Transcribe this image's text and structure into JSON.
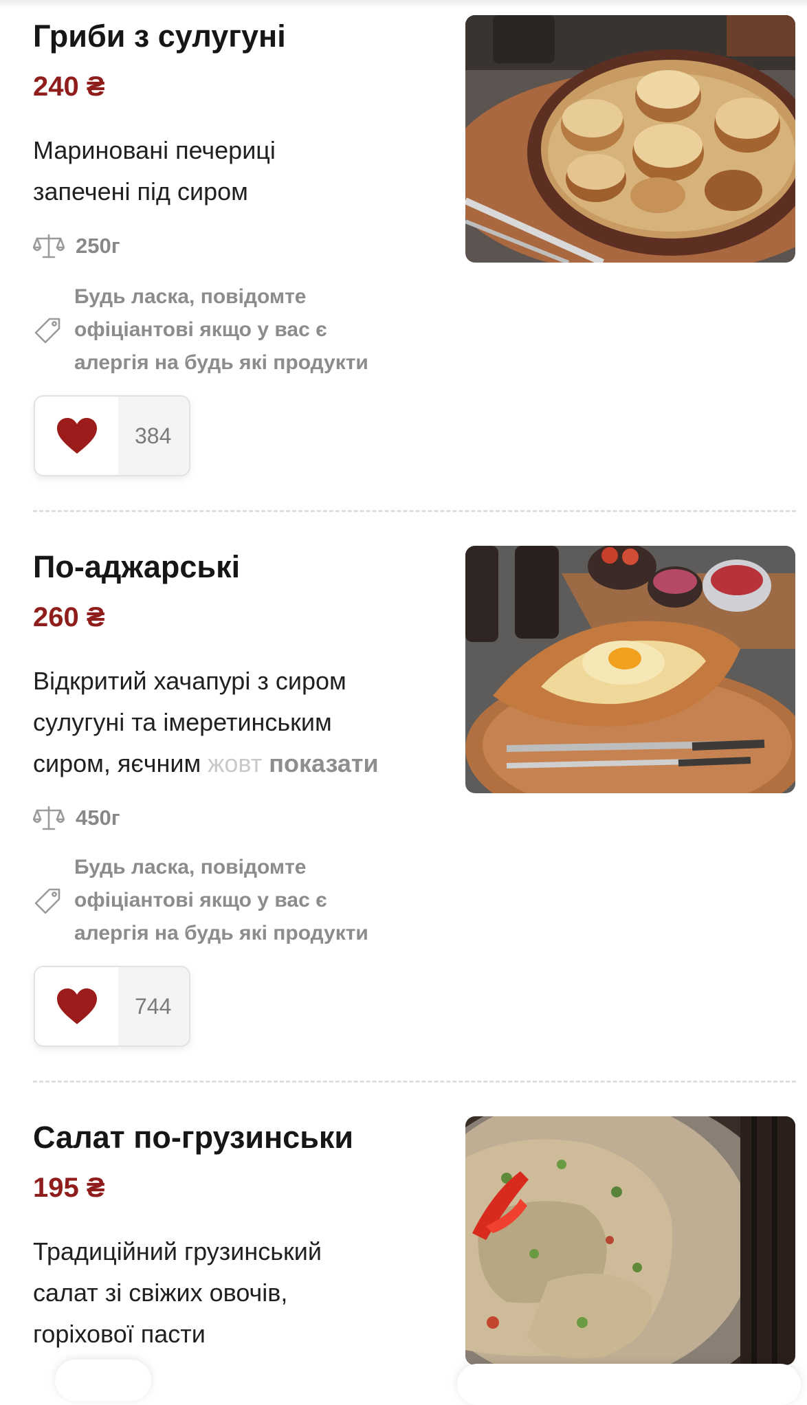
{
  "dishes": [
    {
      "title": "Гриби з сулугуні",
      "price": "240 ₴",
      "description_lines": [
        "Мариновані печериці",
        "запечені під сиром"
      ],
      "weight": "250г",
      "allergy_lines": [
        "Будь ласка, повідомте",
        "офіціантові якщо у вас є",
        "алергія на будь які продукти"
      ],
      "likes": "384",
      "photo_icon": "mushrooms-with-cheese-photo"
    },
    {
      "title": "По-аджарські",
      "price": "260 ₴",
      "description_lines": [
        "Відкритий хачапурі з сиром",
        "сулугуні та імеретинським"
      ],
      "description_last_visible": "сиром, яєчним ",
      "description_last_faded": "жовт",
      "show_more": "показати",
      "weight": "450г",
      "allergy_lines": [
        "Будь ласка, повідомте",
        "офіціантові якщо у вас є",
        "алергія на будь які продукти"
      ],
      "likes": "744",
      "photo_icon": "khachapuri-photo"
    },
    {
      "title": "Салат по-грузинськи",
      "price": "195 ₴",
      "description_lines": [
        "Традиційний грузинський",
        "салат зі свіжих овочів,",
        "горіхової пасти"
      ],
      "photo_icon": "georgian-salad-photo"
    }
  ],
  "colors": {
    "accent": "#8f1d1b",
    "heart": "#9b1c1a",
    "muted": "#8c8c8c"
  },
  "icons": {
    "weight": "scale-icon",
    "allergy": "tag-icon",
    "like": "heart-icon"
  }
}
